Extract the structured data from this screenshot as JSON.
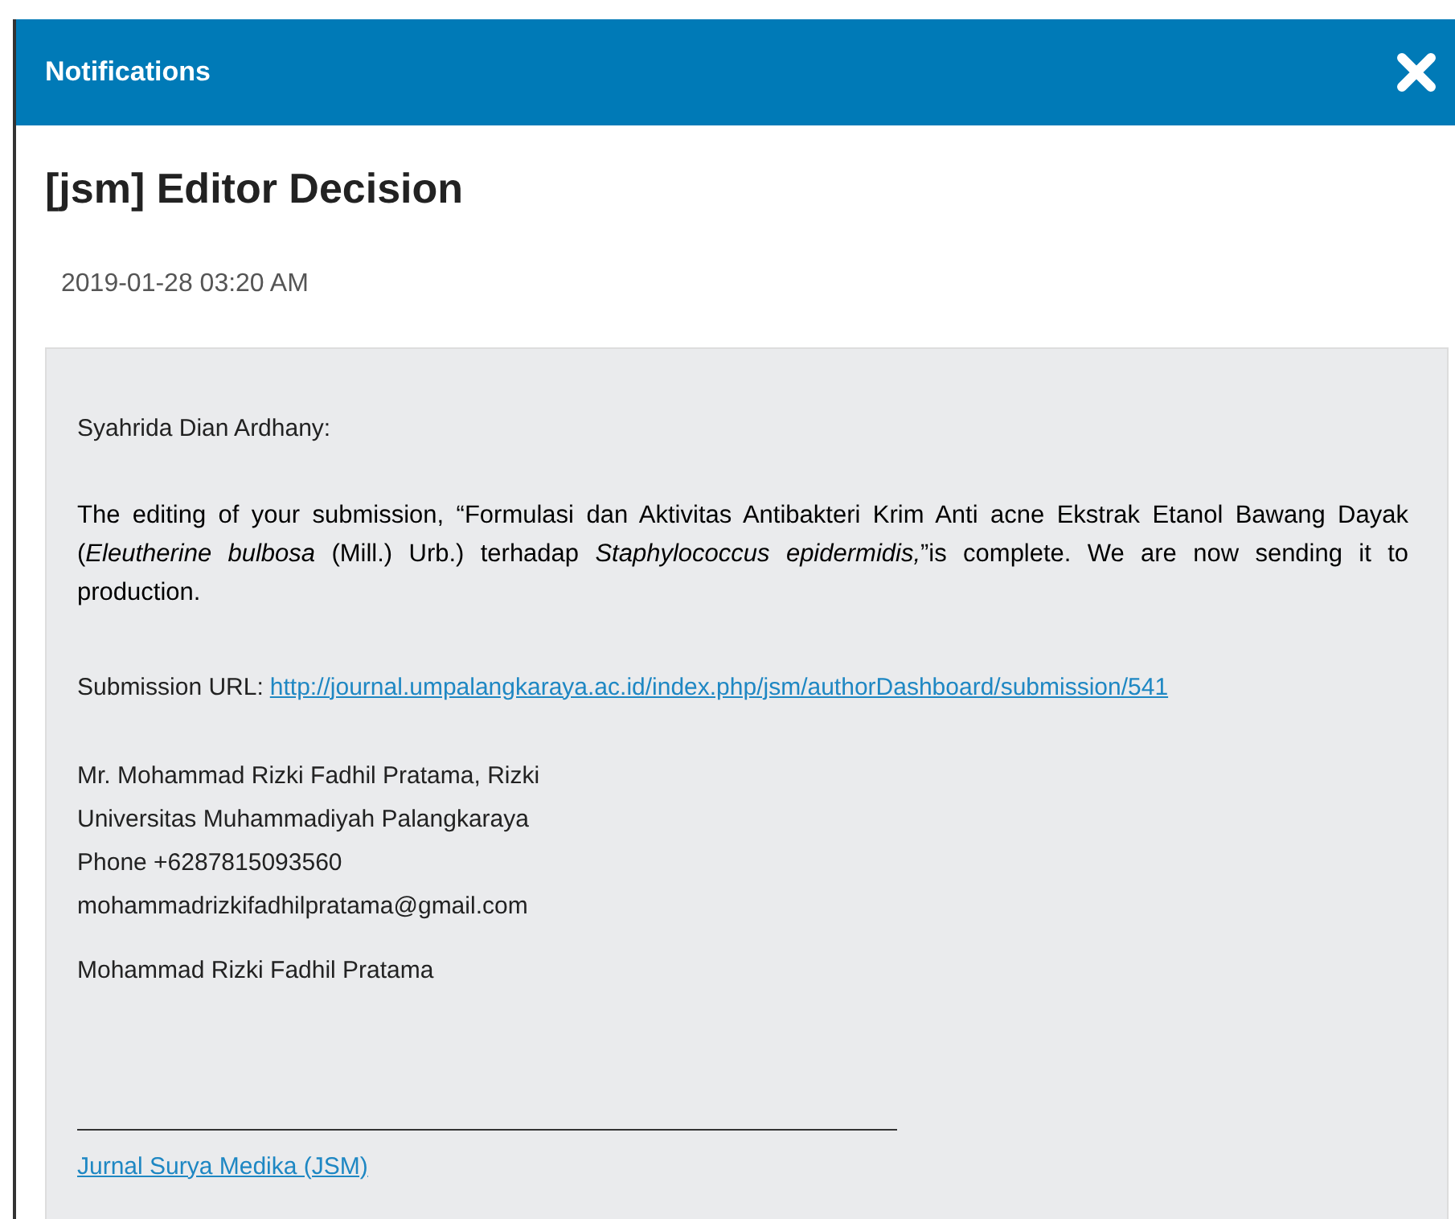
{
  "header": {
    "title": "Notifications"
  },
  "notification": {
    "title": "[jsm] Editor Decision",
    "date": "2019-01-28 03:20 AM"
  },
  "message": {
    "greeting": "Syahrida Dian Ardhany:",
    "body": "The editing of your submission, “Formulasi dan Aktivitas Antibakteri Krim Anti acne Ekstrak Etanol Bawang Dayak (*Eleutherine bulbosa* (Mill.) Urb.) terhadap *Staphylococcus epidermidis,*”is complete. We are now sending it to production.",
    "url_label": "Submission URL:",
    "url": "http://journal.umpalangkaraya.ac.id/index.php/jsm/authorDashboard/submission/541",
    "contact": [
      "Mr. Mohammad Rizki Fadhil Pratama, Rizki",
      "Universitas Muhammadiyah Palangkaraya",
      "Phone +6287815093560",
      "mohammadrizkifadhilpratama@gmail.com"
    ],
    "signature": "Mohammad Rizki Fadhil Pratama",
    "footer_link": "Jurnal Surya Medika (JSM)"
  }
}
